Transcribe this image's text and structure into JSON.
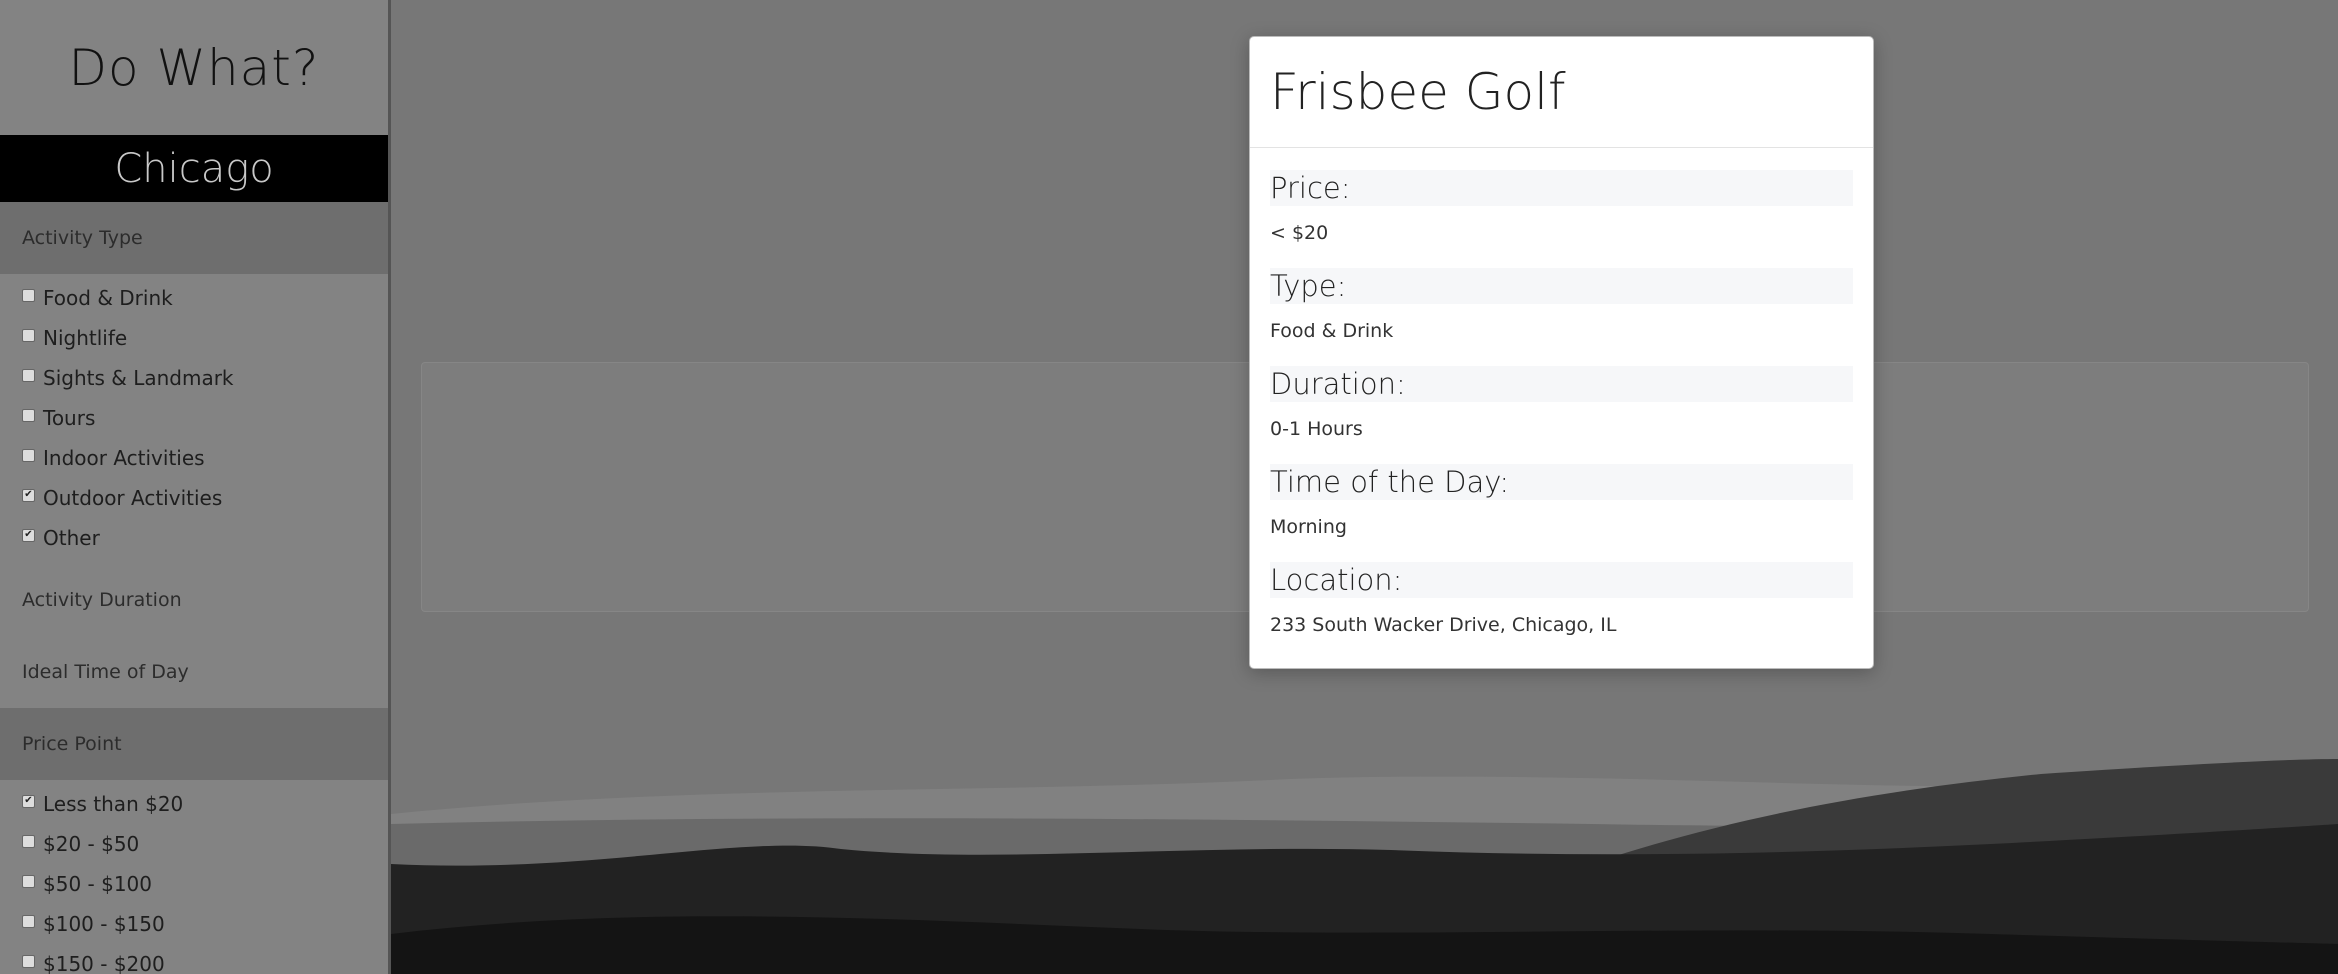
{
  "sidebar": {
    "brand": "Do What?",
    "city": "Chicago",
    "activity_type": {
      "header": "Activity Type",
      "options": [
        {
          "label": "Food & Drink",
          "checked": false
        },
        {
          "label": "Nightlife",
          "checked": false
        },
        {
          "label": "Sights & Landmark",
          "checked": false
        },
        {
          "label": "Tours",
          "checked": false
        },
        {
          "label": "Indoor Activities",
          "checked": false
        },
        {
          "label": "Outdoor Activities",
          "checked": true
        },
        {
          "label": "Other",
          "checked": true
        }
      ]
    },
    "activity_duration": {
      "header": "Activity Duration"
    },
    "ideal_time": {
      "header": "Ideal Time of Day"
    },
    "price_point": {
      "header": "Price Point",
      "options": [
        {
          "label": "Less than $20",
          "checked": true
        },
        {
          "label": "$20 - $50",
          "checked": false
        },
        {
          "label": "$50 - $100",
          "checked": false
        },
        {
          "label": "$100 - $150",
          "checked": false
        },
        {
          "label": "$150 - $200",
          "checked": false
        }
      ]
    }
  },
  "modal": {
    "title": "Frisbee Golf",
    "fields": [
      {
        "label": "Price:",
        "value": "< $20"
      },
      {
        "label": "Type:",
        "value": "Food & Drink"
      },
      {
        "label": "Duration:",
        "value": "0-1 Hours"
      },
      {
        "label": "Time of the Day:",
        "value": "Morning"
      },
      {
        "label": "Location:",
        "value": "233 South Wacker Drive, Chicago, IL"
      }
    ]
  }
}
